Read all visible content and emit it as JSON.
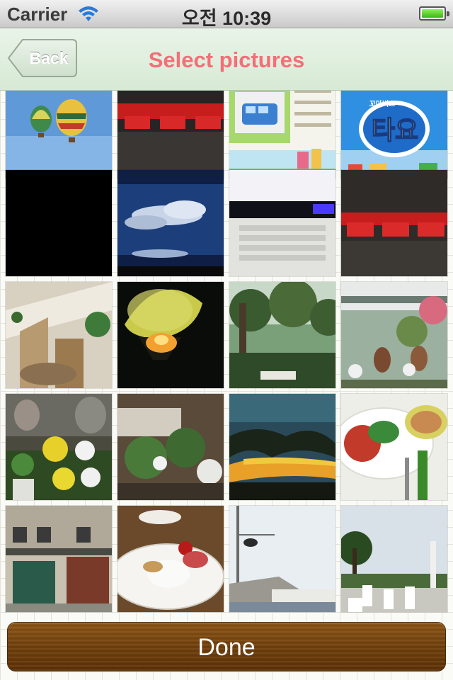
{
  "status_bar": {
    "carrier": "Carrier",
    "time": "오전 10:39",
    "wifi_icon": "wifi-icon",
    "battery_icon": "battery-icon",
    "battery_level": 1.0
  },
  "nav_bar": {
    "back_label": "Back",
    "title": "Select pictures",
    "title_color": "#f56e78"
  },
  "photos": [
    {
      "subject": "hot air balloons in blue sky"
    },
    {
      "subject": "red toy train"
    },
    {
      "subject": "bus cartoon poster"
    },
    {
      "subject": "Tayo the Little Bus logo",
      "logo_text": "꼬마버스 타요"
    },
    {
      "subject": "black frame"
    },
    {
      "subject": "clouds in dark blue sky"
    },
    {
      "subject": "laptop keyboard"
    },
    {
      "subject": "red toy train"
    },
    {
      "subject": "wooden stairs with plants"
    },
    {
      "subject": "glowing balloon at night"
    },
    {
      "subject": "trees and garden bench"
    },
    {
      "subject": "cafe terrace with flowers"
    },
    {
      "subject": "potted flowers and sculptures"
    },
    {
      "subject": "flowers under lattice"
    },
    {
      "subject": "sunset clouds"
    },
    {
      "subject": "salad plate with fork"
    },
    {
      "subject": "building storefront"
    },
    {
      "subject": "dessert plate"
    },
    {
      "subject": "rooftop with cloudy sky"
    },
    {
      "subject": "outdoor cafe with white chairs"
    }
  ],
  "done_button": {
    "label": "Done"
  }
}
